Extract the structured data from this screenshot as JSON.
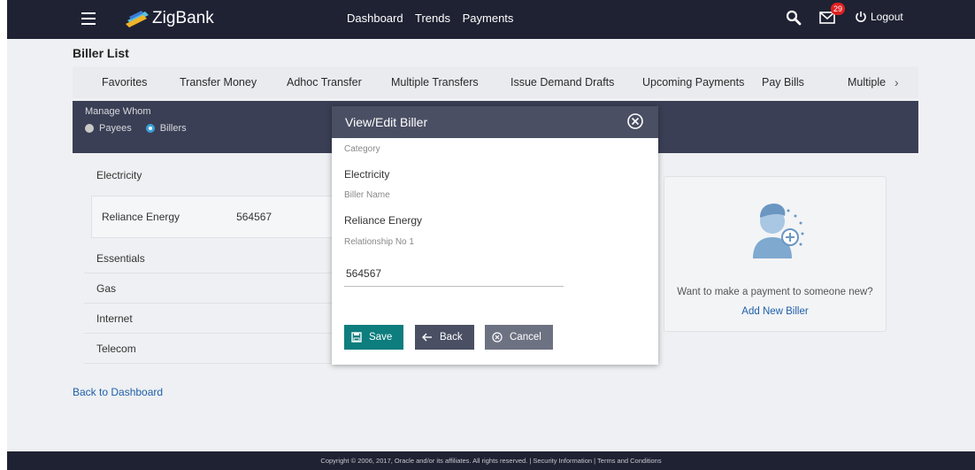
{
  "header": {
    "app_name": "ZigBank",
    "nav": [
      "Dashboard",
      "Trends",
      "Payments"
    ],
    "mail_count": "29",
    "logout_label": "Logout"
  },
  "page": {
    "title": "Biller List",
    "tabs": [
      "Favorites",
      "Transfer Money",
      "Adhoc Transfer",
      "Multiple Transfers",
      "Issue Demand Drafts",
      "Upcoming Payments",
      "Pay Bills",
      "Multiple"
    ],
    "manage_whom_label": "Manage Whom",
    "manage_options": [
      "Payees",
      "Billers"
    ],
    "manage_selected": "Billers"
  },
  "billers": {
    "groups": [
      "Electricity",
      "Essentials",
      "Gas",
      "Internet",
      "Telecom"
    ],
    "electricity_biller": {
      "name": "Reliance Energy",
      "number": "564567"
    }
  },
  "new_biller": {
    "prompt": "Want to make a payment to someone new?",
    "link": "Add New Biller"
  },
  "back_to_dashboard": "Back to Dashboard",
  "footer": "Copyright © 2006, 2017, Oracle and/or its affiliates. All rights reserved. | Security Information | Terms and Conditions",
  "dialog": {
    "title": "View/Edit Biller",
    "category_label": "Category",
    "category_value": "Electricity",
    "biller_name_label": "Biller Name",
    "biller_name_value": "Reliance Energy",
    "relationship_label": "Relationship No 1",
    "relationship_value": "564567",
    "save_label": "Save",
    "back_label": "Back",
    "cancel_label": "Cancel"
  },
  "colors": {
    "header_bg": "#1f2233",
    "manage_bg": "#3b3f55",
    "dialog_header": "#4a4f63",
    "save_button": "#0d7d7e",
    "back_button": "#4a4f63",
    "cancel_button": "#6d7282",
    "link": "#1f5fa8",
    "badge": "#e02020"
  },
  "icons": [
    "menu-icon",
    "zigbank-logo-icon",
    "search-icon",
    "mail-icon",
    "power-icon",
    "close-icon",
    "save-icon",
    "back-arrow-icon",
    "cancel-icon",
    "add-person-icon",
    "chevron-right-icon"
  ]
}
